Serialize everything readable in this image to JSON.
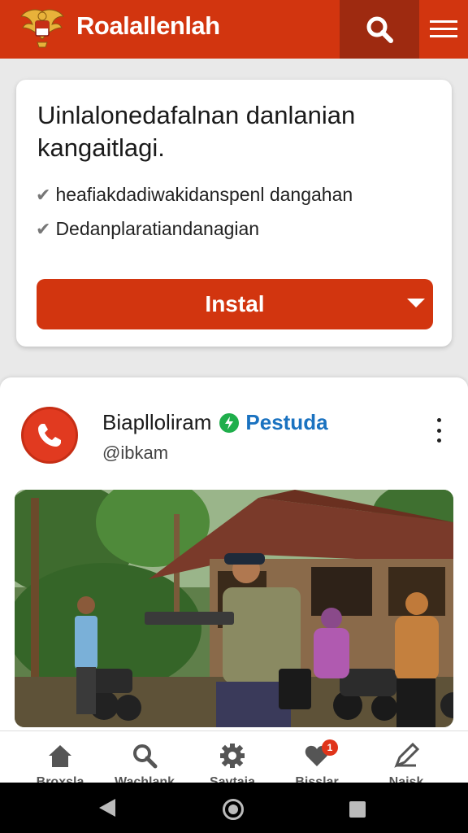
{
  "header": {
    "title": "Roalallenlah",
    "icons": {
      "logo": "garuda-emblem-icon",
      "search": "search-icon",
      "menu": "hamburger-menu-icon"
    },
    "colors": {
      "primary": "#d2350f",
      "search_bg": "#9e2a10"
    }
  },
  "promo": {
    "title": "Uinlalonedafalnan danlanian kangaitlagi.",
    "checks": [
      "heafiakdadiwakidanspenl dangahan",
      "Dedanplaratiandanagian"
    ],
    "install_label": "Instal"
  },
  "post": {
    "author": "Biaplloliram",
    "badge": "Pestuda",
    "handle": "@ibkam",
    "avatar_icon": "phone-icon",
    "more_icon": "kebab-menu-icon"
  },
  "bottom_nav": {
    "items": [
      {
        "label": "Broxsla",
        "icon": "home-icon"
      },
      {
        "label": "Wachlank",
        "icon": "search-icon"
      },
      {
        "label": "Savtaia",
        "icon": "gear-icon"
      },
      {
        "label": "Bisslar",
        "icon": "heart-icon",
        "badge": "1"
      },
      {
        "label": "Naisk",
        "icon": "pen-icon"
      }
    ]
  },
  "system_nav": {
    "icons": [
      "back-icon",
      "home-circle-icon",
      "recent-apps-icon"
    ]
  }
}
